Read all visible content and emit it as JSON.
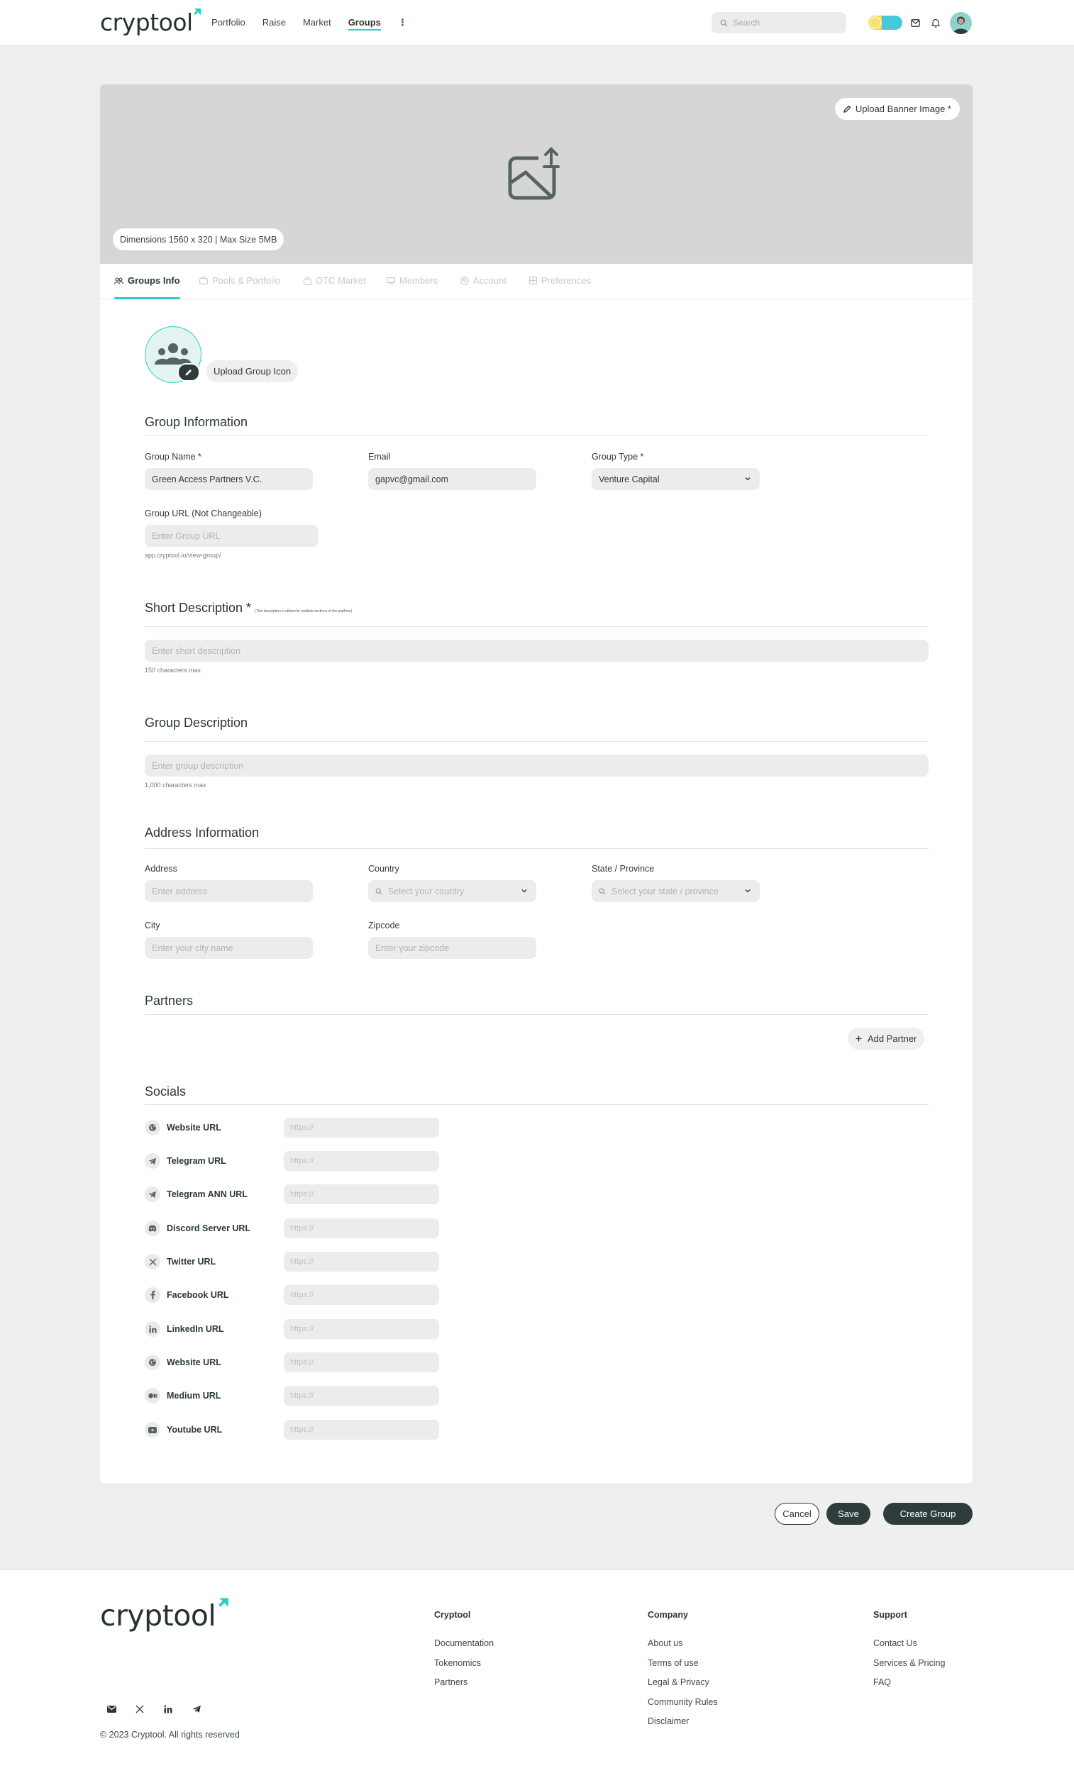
{
  "header": {
    "logo": "cryptool",
    "nav": [
      "Portfolio",
      "Raise",
      "Market",
      "Groups"
    ],
    "active_nav": "Groups",
    "more": "⋮",
    "search_placeholder": "Search"
  },
  "banner": {
    "upload_label": "Upload Banner Image *",
    "dimensions": "Dimensions 1560 x 320 | Max Size 5MB"
  },
  "tabs": [
    "Groups Info",
    "Pools & Portfolio",
    "OTC Market",
    "Members",
    "Account",
    "Preferences"
  ],
  "group_icon": {
    "upload_label": "Upload Group Icon"
  },
  "group_info": {
    "title": "Group Information",
    "name_label": "Group Name *",
    "name_value": "Green Access Partners V.C.",
    "email_label": "Email",
    "email_value": "gapvc@gmail.com",
    "type_label": "Group Type *",
    "type_value": "Venture Capital",
    "url_label": "Group URL (Not Changeable)",
    "url_placeholder": "Enter Group URL",
    "url_hint": "app.cryptool.io/view-group/"
  },
  "short_description": {
    "title": "Short Description *",
    "note": "(This description is utilized in multiple sections of the platform)",
    "placeholder": "Enter short description",
    "hint": "150 characters max"
  },
  "group_description": {
    "title": "Group Description",
    "placeholder": "Enter group description",
    "hint": "1,000 characters max"
  },
  "address": {
    "title": "Address Information",
    "address_label": "Address",
    "address_placeholder": "Enter address",
    "country_label": "Country",
    "country_placeholder": "Select your country",
    "state_label": "State / Province",
    "state_placeholder": "Select your state / province",
    "city_label": "City",
    "city_placeholder": "Enter your city name",
    "zip_label": "Zipcode",
    "zip_placeholder": "Enter your zipcode"
  },
  "partners": {
    "title": "Partners",
    "add_label": "Add Partner"
  },
  "socials": {
    "title": "Socials",
    "placeholder": "https://",
    "items": [
      {
        "label": "Website URL",
        "icon": "globe-icon"
      },
      {
        "label": "Telegram URL",
        "icon": "telegram-icon"
      },
      {
        "label": "Telegram ANN URL",
        "icon": "telegram-icon"
      },
      {
        "label": "Discord Server URL",
        "icon": "discord-icon"
      },
      {
        "label": "Twitter URL",
        "icon": "x-icon"
      },
      {
        "label": "Facebook URL",
        "icon": "facebook-icon"
      },
      {
        "label": "LinkedIn URL",
        "icon": "linkedin-icon"
      },
      {
        "label": "Website URL",
        "icon": "globe-icon"
      },
      {
        "label": "Medium URL",
        "icon": "medium-icon"
      },
      {
        "label": "Youtube URL",
        "icon": "youtube-icon"
      }
    ]
  },
  "actions": {
    "cancel": "Cancel",
    "save": "Save",
    "create": "Create Group"
  },
  "footer": {
    "logo": "cryptool",
    "columns": [
      {
        "title": "Cryptool",
        "links": [
          "Documentation",
          "Tokenomics",
          "Partners"
        ]
      },
      {
        "title": "Company",
        "links": [
          "About us",
          "Terms of use",
          "Legal & Privacy",
          "Community Rules",
          "Disclaimer"
        ]
      },
      {
        "title": "Support",
        "links": [
          "Contact Us",
          "Services & Pricing",
          "FAQ"
        ]
      }
    ],
    "copyright": "© 2023 Cryptool. All rights reserved"
  },
  "colors": {
    "accent": "#29cfc7",
    "dark": "#2e3c3b",
    "field_bg": "#ececec"
  }
}
